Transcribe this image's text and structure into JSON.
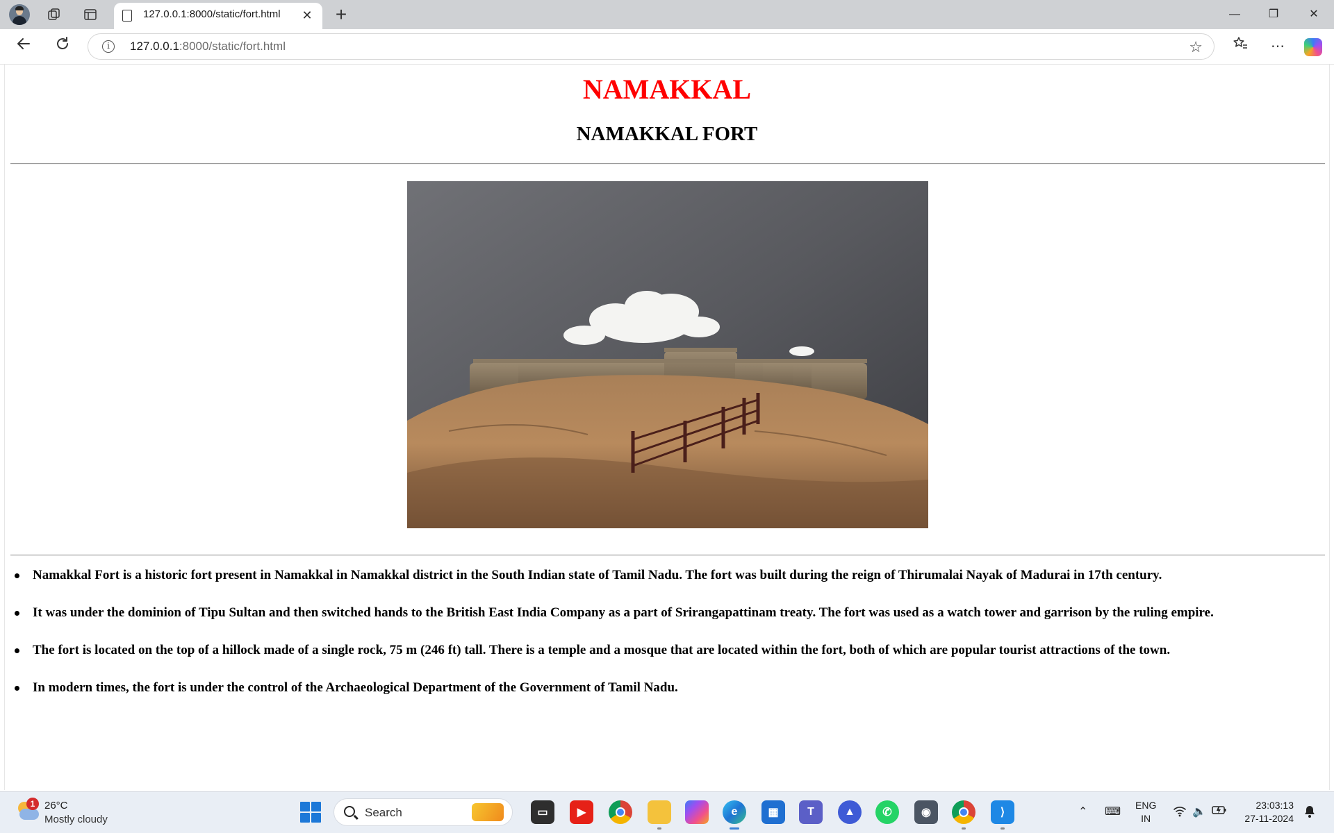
{
  "browser": {
    "tab_title": "127.0.0.1:8000/static/fort.html",
    "tab_close_glyph": "✕",
    "new_tab_glyph": "+",
    "url_host": "127.0.0.1",
    "url_rest": ":8000/static/fort.html",
    "window": {
      "minimize": "—",
      "restore": "❐",
      "close": "✕"
    }
  },
  "page": {
    "heading": "NAMAKKAL",
    "subheading": "NAMAKKAL FORT",
    "heading_color": "#ff0000",
    "facts": [
      "Namakkal Fort is a historic fort present in Namakkal in Namakkal district in the South Indian state of Tamil Nadu. The fort was built during the reign of Thirumalai Nayak of Madurai in 17th century.",
      "It was under the dominion of Tipu Sultan and then switched hands to the British East India Company as a part of Srirangapattinam treaty. The fort was used as a watch tower and garrison by the ruling empire.",
      "The fort is located on the top of a hillock made of a single rock, 75 m (246 ft) tall. There is a temple and a mosque that are located within the fort, both of which are popular tourist attractions of the town.",
      "In modern times, the fort is under the control of the Archaeological Department of the Government of Tamil Nadu."
    ]
  },
  "taskbar": {
    "weather_badge": "1",
    "weather_temp": "26°C",
    "weather_desc": "Mostly cloudy",
    "search_label": "Search",
    "lang_line1": "ENG",
    "lang_line2": "IN",
    "time": "23:03:13",
    "date": "27-11-2024",
    "apps": [
      "file-manager",
      "youtube",
      "chrome",
      "file-explorer",
      "copilot",
      "edge",
      "microsoft-store",
      "teams",
      "affinity",
      "whatsapp",
      "camera",
      "chrome-profile",
      "vscode"
    ]
  }
}
